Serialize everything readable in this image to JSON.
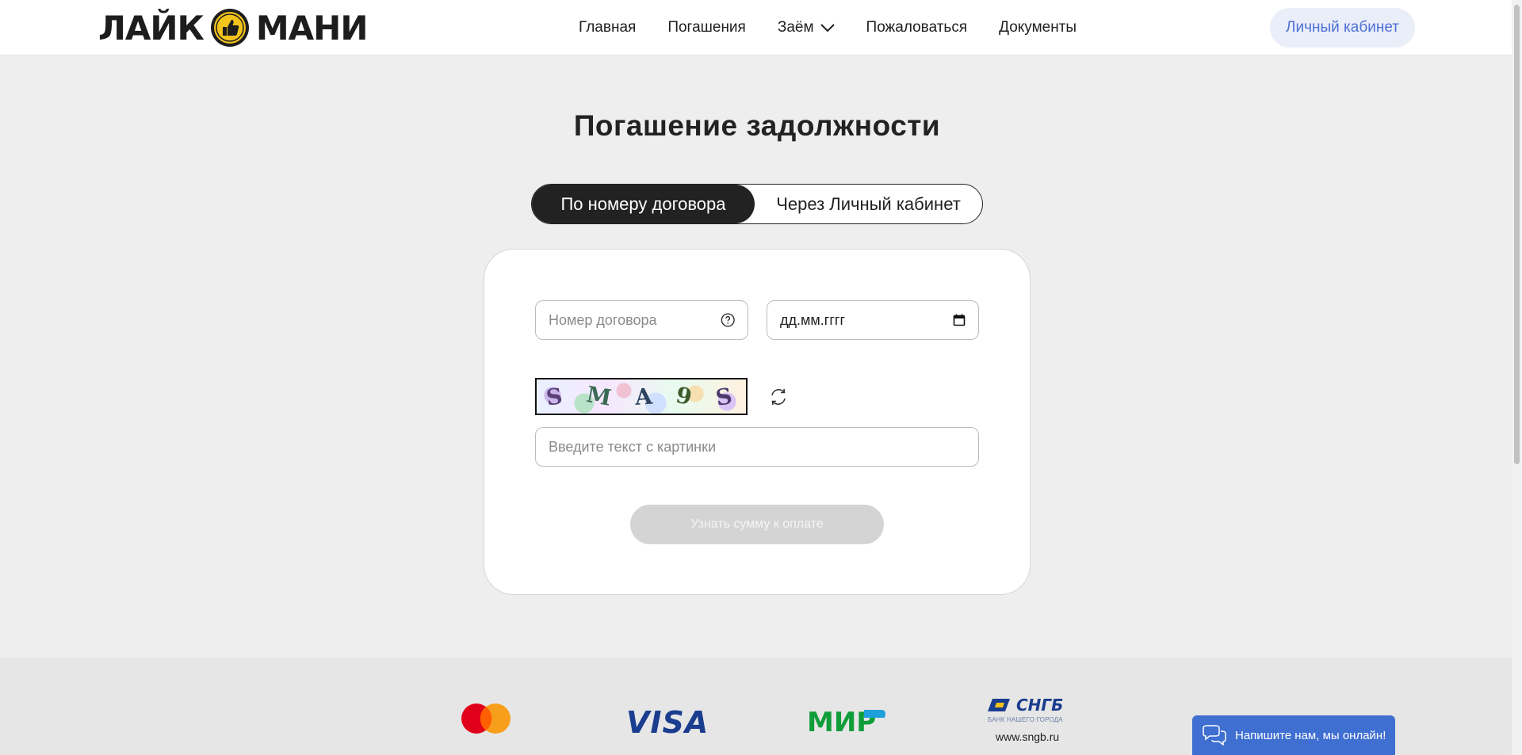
{
  "header": {
    "logo_left": "ЛАЙК",
    "logo_right": "МАНИ",
    "nav": [
      {
        "label": "Главная"
      },
      {
        "label": "Погашения"
      },
      {
        "label": "Заём"
      },
      {
        "label": "Пожаловаться"
      },
      {
        "label": "Документы"
      }
    ],
    "cabinet_label": "Личный кабинет"
  },
  "main": {
    "title": "Погашение задолжности",
    "tabs": [
      {
        "label": "По номеру договора",
        "active": true
      },
      {
        "label": "Через Личный кабинет",
        "active": false
      }
    ],
    "form": {
      "contract_placeholder": "Номер договора",
      "date_placeholder": "дд.мм.гггг",
      "captcha_text": "SMA9S",
      "captcha_placeholder": "Введите текст с картинки",
      "submit_label": "Узнать сумму к оплате"
    }
  },
  "footer": {
    "payments": [
      {
        "name": "mastercard-logo"
      },
      {
        "name": "visa-logo",
        "text": "VISA"
      },
      {
        "name": "mir-logo",
        "text": "МИР"
      },
      {
        "name": "sngb-logo",
        "text": "СНГБ",
        "sub": "БАНК НАШЕГО ГОРОДА",
        "url": "www.sngb.ru"
      }
    ]
  },
  "chat": {
    "label": "Напишите нам, мы онлайн!"
  },
  "colors": {
    "accent_blue": "#4d6fd6",
    "dark": "#222222",
    "chat_blue": "#3f6fd1"
  }
}
